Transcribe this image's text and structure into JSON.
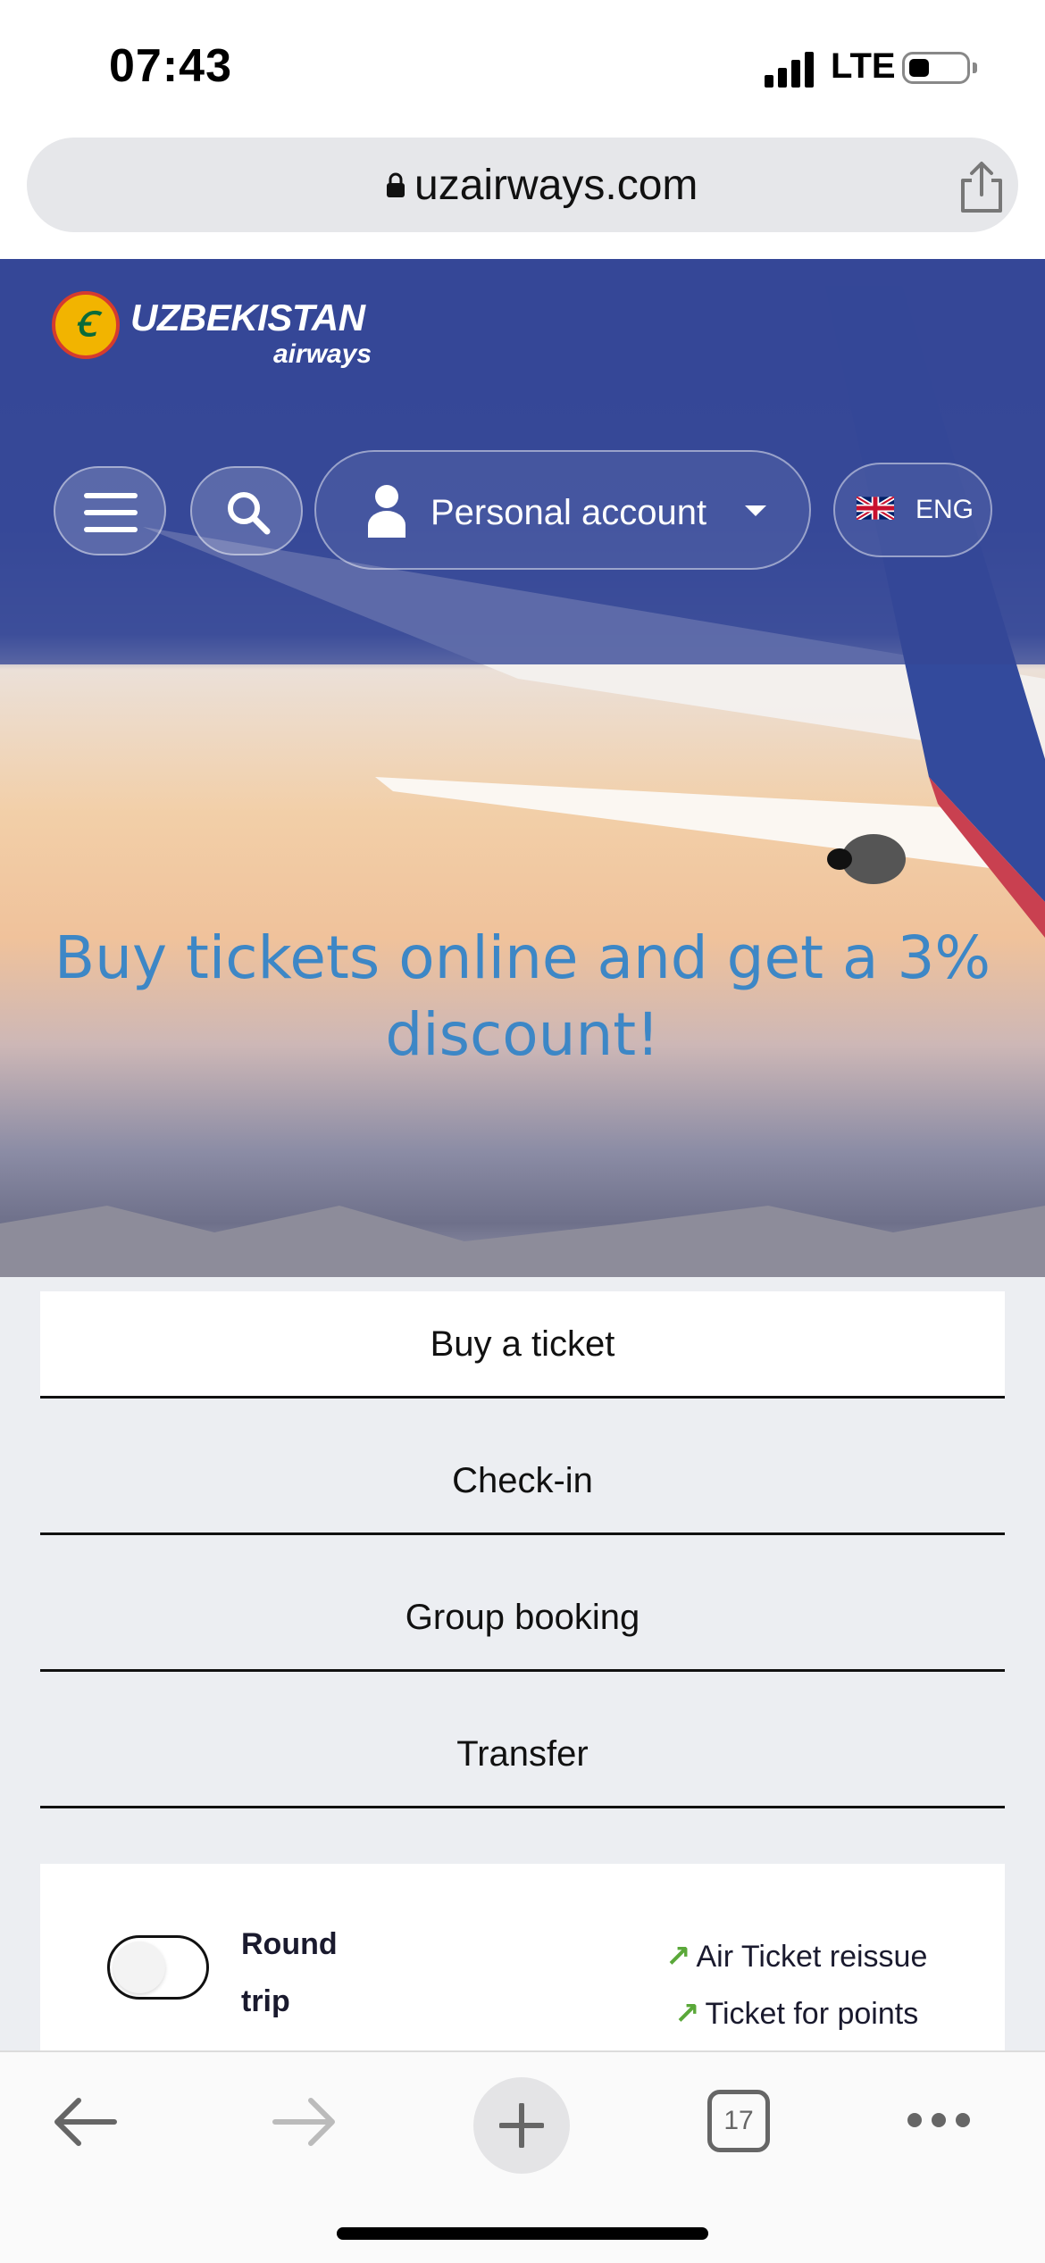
{
  "status_bar": {
    "time": "07:43",
    "network": "LTE"
  },
  "browser": {
    "url": "uzairways.com",
    "tab_count": "17"
  },
  "header": {
    "logo_text": "UZBEKISTAN",
    "logo_subtext": "airways",
    "account_label": "Personal account",
    "language": "ENG"
  },
  "promo": {
    "headline": "Buy tickets online and get a 3% discount!"
  },
  "tabs": [
    {
      "label": "Buy a ticket",
      "active": true
    },
    {
      "label": "Check-in",
      "active": false
    },
    {
      "label": "Group booking",
      "active": false
    },
    {
      "label": "Transfer",
      "active": false
    }
  ],
  "booking": {
    "round_trip_label": "Round trip",
    "round_trip_enabled": false,
    "links": [
      "Air Ticket reissue",
      "Ticket for points"
    ]
  },
  "colors": {
    "header_blue": "#37499a",
    "promo_text": "#3d87c6",
    "link_arrow": "#5aa839"
  }
}
